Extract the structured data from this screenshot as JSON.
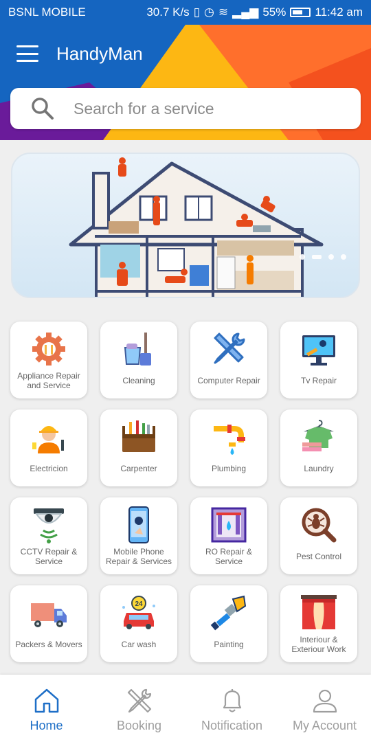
{
  "status_bar": {
    "carrier": "BSNL MOBILE",
    "speed": "30.7 K/s",
    "battery": "55%",
    "time": "11:42 am"
  },
  "app": {
    "title": "HandyMan"
  },
  "search": {
    "placeholder": "Search for a service"
  },
  "banner": {
    "slides": 4,
    "active_slide": 1
  },
  "services": [
    {
      "label": "Appliance Repair and Service",
      "icon": "gear-wrench-icon"
    },
    {
      "label": "Cleaning",
      "icon": "bucket-mop-icon"
    },
    {
      "label": "Computer Repair",
      "icon": "crossed-tools-icon"
    },
    {
      "label": "Tv Repair",
      "icon": "monitor-icon"
    },
    {
      "label": "Electricion",
      "icon": "electrician-icon"
    },
    {
      "label": "Carpenter",
      "icon": "toolbox-icon"
    },
    {
      "label": "Plumbing",
      "icon": "pipe-icon"
    },
    {
      "label": "Laundry",
      "icon": "shirt-hanger-icon"
    },
    {
      "label": "CCTV Repair & Service",
      "icon": "cctv-camera-icon"
    },
    {
      "label": "Mobile Phone Repair & Services",
      "icon": "phone-icon"
    },
    {
      "label": "RO Repair & Service",
      "icon": "water-filter-icon"
    },
    {
      "label": "Pest Control",
      "icon": "bug-magnifier-icon"
    },
    {
      "label": "Packers & Movers",
      "icon": "truck-icon"
    },
    {
      "label": "Car wash",
      "icon": "car-icon"
    },
    {
      "label": "Painting",
      "icon": "paint-brush-icon"
    },
    {
      "label": "Interiour & Exteriour Work",
      "icon": "curtain-icon"
    }
  ],
  "bottom_nav": [
    {
      "label": "Home",
      "icon": "home-icon",
      "active": true
    },
    {
      "label": "Booking",
      "icon": "tools-icon",
      "active": false
    },
    {
      "label": "Notification",
      "icon": "bell-icon",
      "active": false
    },
    {
      "label": "My Account",
      "icon": "user-icon",
      "active": false
    }
  ],
  "colors": {
    "primary": "#1565c0",
    "accent_yellow": "#fdb713",
    "accent_orange": "#ff6f2c",
    "accent_purple": "#6a1b9a",
    "active_nav": "#1e6fc7"
  }
}
